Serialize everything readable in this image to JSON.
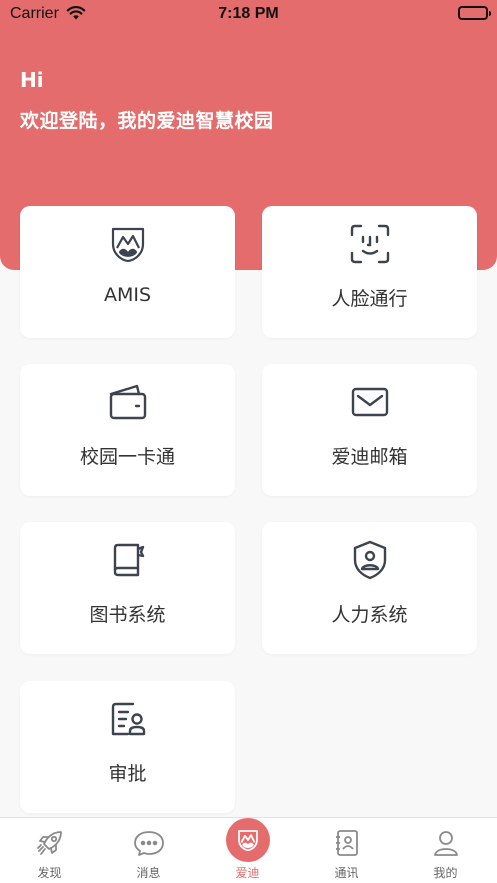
{
  "status_bar": {
    "carrier": "Carrier",
    "time": "7:18 PM"
  },
  "header": {
    "hi": "Hi",
    "welcome": "欢迎登陆，我的爱迪智慧校园"
  },
  "tiles": [
    {
      "label": "AMIS",
      "icon": "amis-logo-icon"
    },
    {
      "label": "人脸通行",
      "icon": "face-scan-icon"
    },
    {
      "label": "校园一卡通",
      "icon": "wallet-card-icon"
    },
    {
      "label": "爱迪邮箱",
      "icon": "mail-icon"
    },
    {
      "label": "图书系统",
      "icon": "book-icon"
    },
    {
      "label": "人力系统",
      "icon": "shield-user-icon"
    },
    {
      "label": "审批",
      "icon": "approval-doc-icon"
    }
  ],
  "tabbar": {
    "active": "爱迪",
    "items": [
      {
        "label": "发现",
        "icon": "rocket-icon"
      },
      {
        "label": "消息",
        "icon": "chat-icon"
      },
      {
        "label": "爱迪",
        "icon": "amis-logo-icon"
      },
      {
        "label": "通讯",
        "icon": "contacts-book-icon"
      },
      {
        "label": "我的",
        "icon": "user-icon"
      }
    ]
  },
  "colors": {
    "accent": "#e46c6c",
    "background": "#f8f8f8",
    "icon": "#3d4350"
  }
}
